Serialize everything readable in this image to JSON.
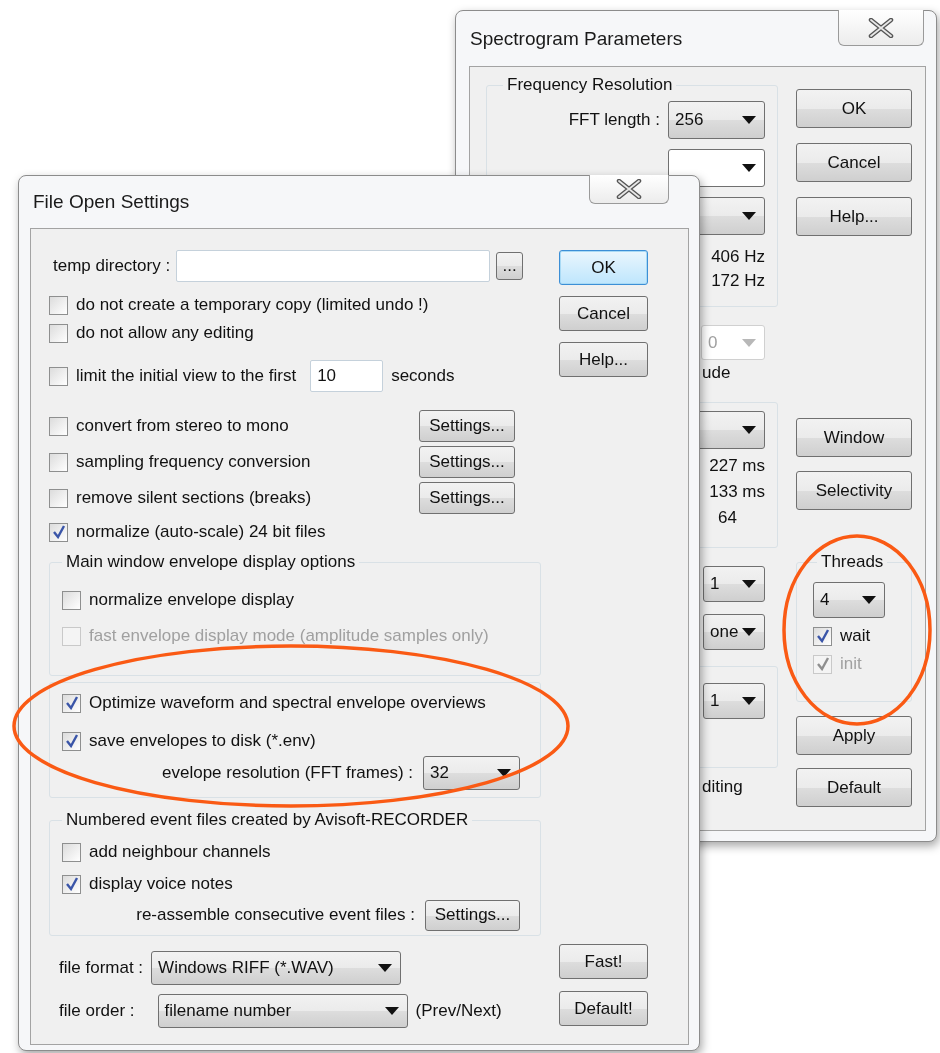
{
  "spectrogram_dialog": {
    "title": "Spectrogram Parameters",
    "frequency_group": {
      "title": "Frequency Resolution",
      "fft_label": "FFT length :",
      "fft_value": "256",
      "readings": [
        "406 Hz",
        "172 Hz"
      ]
    },
    "amplitude": {
      "value": "0",
      "disabled": true,
      "caption": "ude"
    },
    "time_group": {
      "readings": [
        "227 ms",
        "133 ms",
        "64"
      ]
    },
    "dropdowns": [
      {
        "value": "1"
      },
      {
        "value": "one"
      }
    ],
    "lower_group": {
      "value": "1"
    },
    "footer_text": "diting",
    "top_buttons": [
      "OK",
      "Cancel",
      "Help..."
    ],
    "middle_buttons": [
      "Window",
      "Selectivity"
    ],
    "threads": {
      "title": "Threads",
      "value": "4",
      "options": [
        {
          "label": "wait",
          "checked": true,
          "disabled": false
        },
        {
          "label": "init",
          "checked": true,
          "disabled": true
        }
      ]
    },
    "bottom_buttons": [
      "Apply",
      "Default"
    ]
  },
  "file_dialog": {
    "title": "File Open Settings",
    "temp_dir": {
      "label": "temp directory :",
      "browse": "..."
    },
    "options": [
      {
        "label": "do not create a temporary copy (limited undo !)",
        "checked": false
      },
      {
        "label": "do not allow any editing",
        "checked": false
      }
    ],
    "limit_view": {
      "label": "limit the initial view to the first",
      "checked": false,
      "value": "10",
      "unit": "seconds"
    },
    "conversions": [
      {
        "label": "convert from stereo to mono",
        "checked": false,
        "button": "Settings..."
      },
      {
        "label": "sampling frequency conversion",
        "checked": false,
        "button": "Settings..."
      },
      {
        "label": "remove silent sections (breaks)",
        "checked": false,
        "button": "Settings..."
      },
      {
        "label": "normalize (auto-scale) 24 bit files",
        "checked": true
      }
    ],
    "envelope_group": {
      "title": "Main window envelope display options",
      "options": [
        {
          "label": "normalize envelope display",
          "checked": false,
          "disabled": false
        },
        {
          "label": "fast envelope display mode (amplitude samples only)",
          "checked": false,
          "disabled": true
        }
      ]
    },
    "overview_group": {
      "options": [
        {
          "label": "Optimize waveform and spectral envelope overviews",
          "checked": true
        },
        {
          "label": "save envelopes to disk (*.env)",
          "checked": true
        }
      ],
      "resolution": {
        "label": "evelope resolution (FFT frames) :",
        "value": "32"
      }
    },
    "event_group": {
      "title": "Numbered event files created by Avisoft-RECORDER",
      "options": [
        {
          "label": "add neighbour channels",
          "checked": false
        },
        {
          "label": "display voice notes",
          "checked": true
        }
      ],
      "reassemble": {
        "label": "re-assemble consecutive event files :",
        "button": "Settings..."
      }
    },
    "file_format": {
      "label": "file format :",
      "value": "Windows RIFF (*.WAV)"
    },
    "file_order": {
      "label": "file order :",
      "value": "filename number",
      "note": "(Prev/Next)"
    },
    "buttons": [
      {
        "label": "OK",
        "default": true
      },
      {
        "label": "Cancel",
        "default": false
      },
      {
        "label": "Help...",
        "default": false
      }
    ],
    "bottom_buttons": [
      "Fast!",
      "Default!"
    ]
  }
}
